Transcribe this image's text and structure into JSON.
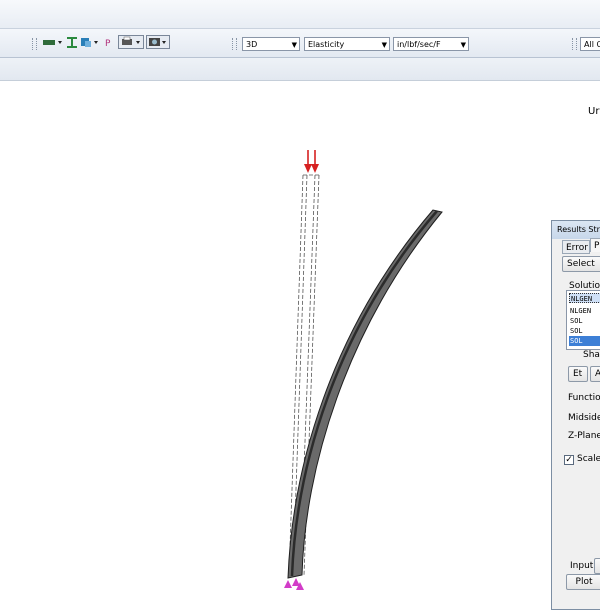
{
  "toolbar": {
    "view_dropdown": "3D",
    "result_dropdown": "Elasticity",
    "units_dropdown": "in/lbf/sec/F",
    "filter_dropdown": "All O"
  },
  "canvas": {
    "units_label": "Ur"
  },
  "results_panel": {
    "title": "Results Stre",
    "tabs": [
      "Error",
      "P"
    ],
    "select_button": "Select",
    "solution_label": "Solution",
    "solutions": [
      "NLGEN",
      "NLGEN",
      "SOL",
      "SOL",
      "SOL"
    ],
    "shape_label": "Shap",
    "et_button": "Et",
    "a_button": "A",
    "functions_label": "Functions",
    "midsides_label": "Midsides",
    "zplane_label": "Z-Plane:",
    "scale_label": "Scale:",
    "scale_checked": "✓",
    "input_label": "Input",
    "plot_button": "Plot"
  },
  "colors": {
    "load_arrow": "#d62020",
    "constraint": "#d23cc8",
    "beam_fill": "#505050",
    "selection": "#3d7fd6"
  }
}
